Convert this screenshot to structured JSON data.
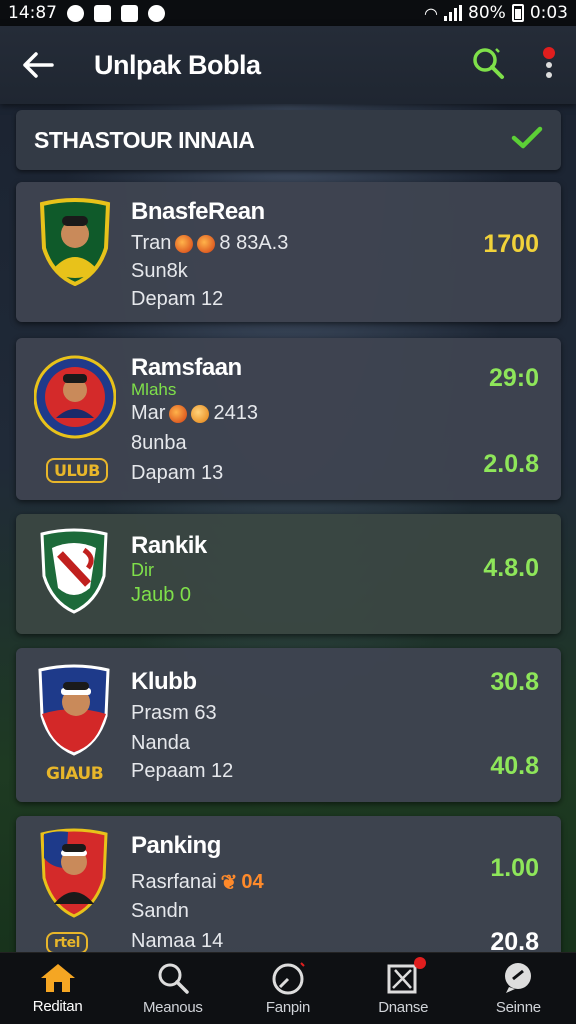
{
  "status_bar": {
    "time": "14:87",
    "battery": "80%",
    "clock": "0:03",
    "icons": [
      "circle-icon",
      "mail-icon",
      "x-icon",
      "shield-icon"
    ]
  },
  "app_bar": {
    "title": "Unlpak Bobla",
    "back_icon": "arrow-left-icon",
    "search_icon": "search-icon",
    "more_icon": "more-vertical-icon"
  },
  "section": {
    "title": "STHASTOUR INNAIA",
    "check_icon": "check-icon"
  },
  "cards": [
    {
      "name": "BnasfeRean",
      "line1": "Tran",
      "line1_suffix": "8 83A.3",
      "line2": "Sun8k",
      "line3": "Depam 12",
      "value": "1700",
      "value_color": "#f1d23a",
      "crest_colors": [
        "#0f5a2a",
        "#e8c21a"
      ]
    },
    {
      "name": "Ramsfaan",
      "sub": "Mlahs",
      "line1": "Mar",
      "line1_suffix": "2413",
      "line2": "8unba",
      "line3": "Dapam 13",
      "club_tag": "ULUB",
      "value": "29:0",
      "value2": "2.0.8",
      "crest_colors": [
        "#1f3a8a",
        "#d42a2a"
      ]
    },
    {
      "name": "Rankik",
      "line1": "Dir",
      "line2": "Jaub 0",
      "value": "4.8.0",
      "crest_colors": [
        "#1d6a3a",
        "#c0201e"
      ]
    },
    {
      "name": "Klubb",
      "line1": "Prasm 63",
      "line2": "Nanda",
      "line3": "Pepaam 12",
      "club_tag": "GIAUB",
      "value": "30.8",
      "value2": "40.8",
      "crest_colors": [
        "#1e3a8a",
        "#d32828"
      ]
    },
    {
      "name": "Panking",
      "line1": "Rasrfanai",
      "line1_suffix": "04",
      "line2": "Sandn",
      "line3": "Namaa 14",
      "club_tag": "rtel",
      "value": "1.00",
      "value2": "20.8",
      "crest_colors": [
        "#1e3a8a",
        "#d42a2a"
      ]
    }
  ],
  "bottom_nav": [
    {
      "label": "Reditan",
      "icon": "home-icon",
      "active": true
    },
    {
      "label": "Meanous",
      "icon": "search-icon",
      "active": false
    },
    {
      "label": "Fanpin",
      "icon": "gauge-icon",
      "active": false
    },
    {
      "label": "Dnanse",
      "icon": "pitch-icon",
      "active": false
    },
    {
      "label": "Seinne",
      "icon": "chat-icon",
      "active": false
    }
  ],
  "colors": {
    "accent_green": "#8ee65a",
    "accent_yellow": "#f1d23a",
    "nav_active": "#f5a623"
  }
}
